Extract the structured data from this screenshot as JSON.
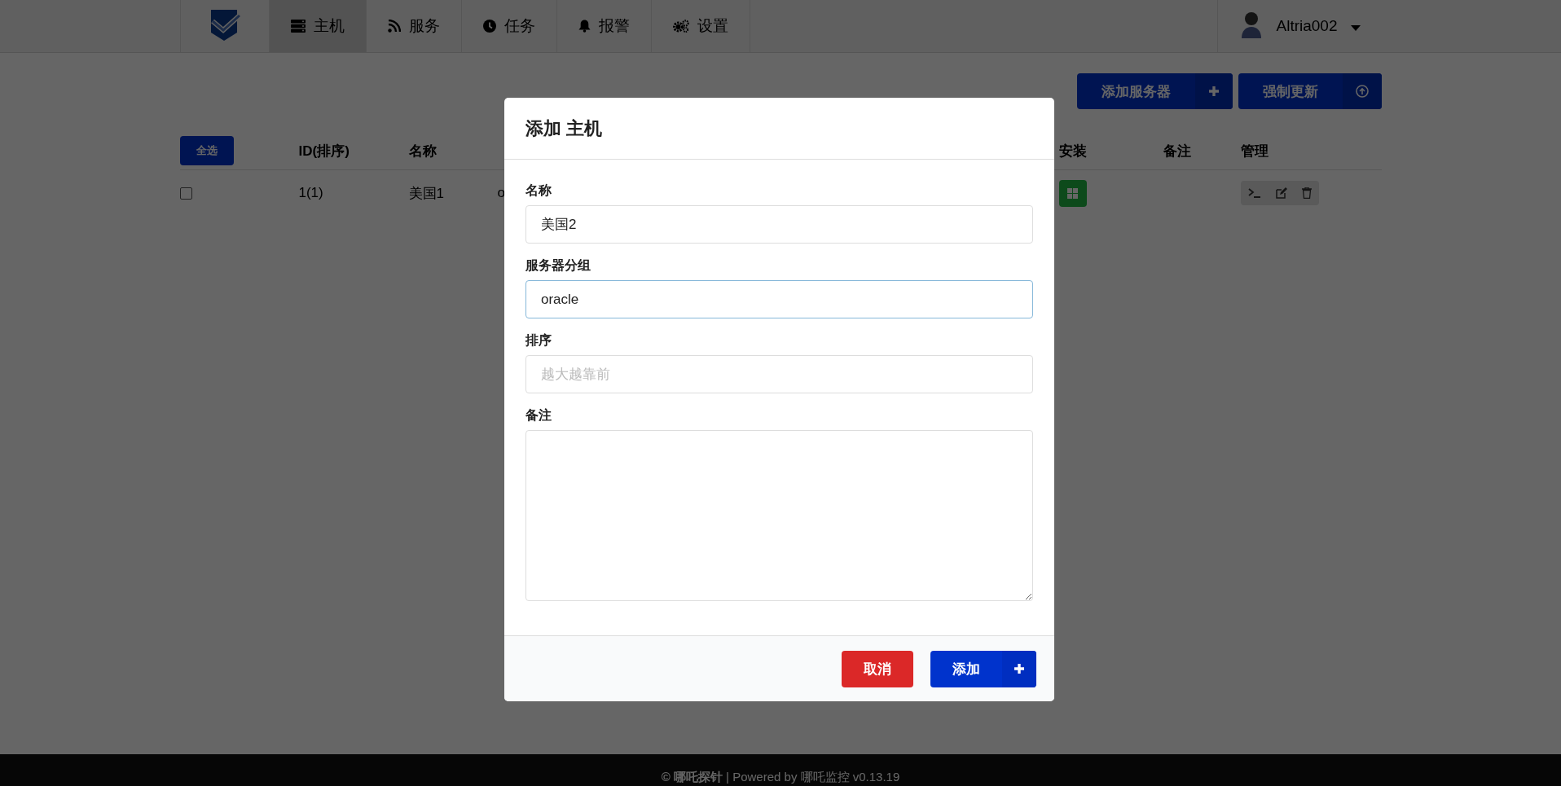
{
  "nav": {
    "items": [
      {
        "label": "主机",
        "selected": true
      },
      {
        "label": "服务",
        "selected": false
      },
      {
        "label": "任务",
        "selected": false
      },
      {
        "label": "报警",
        "selected": false
      },
      {
        "label": "设置",
        "selected": false
      }
    ],
    "user": {
      "name": "Altria002"
    }
  },
  "toolbar": {
    "buttons": [
      {
        "label": "添加服务器"
      },
      {
        "label": "强制更新"
      }
    ]
  },
  "table": {
    "select_all": "全选",
    "columns": [
      "ID(排序)",
      "名称",
      "安装",
      "备注",
      "管理"
    ],
    "rows": [
      {
        "checked": false,
        "cells": [
          "1(1)",
          "美国1",
          "o"
        ]
      }
    ]
  },
  "modal": {
    "title": "添加 主机",
    "fields": [
      {
        "kind": "input",
        "label": "名称",
        "value": "美国2",
        "focused": false
      },
      {
        "kind": "input",
        "label": "服务器分组",
        "value": "oracle",
        "focused": true
      },
      {
        "kind": "input",
        "label": "排序",
        "placeholder": "越大越靠前",
        "focused": false
      },
      {
        "kind": "textarea",
        "label": "备注",
        "focused": false
      }
    ],
    "buttons": [
      {
        "kind": "cancel",
        "label": "取消"
      },
      {
        "kind": "add",
        "label": "添加"
      }
    ]
  },
  "footer": {
    "text": "**© 哪吒探针** | Powered by 哪吒监控 v0.13.19"
  }
}
